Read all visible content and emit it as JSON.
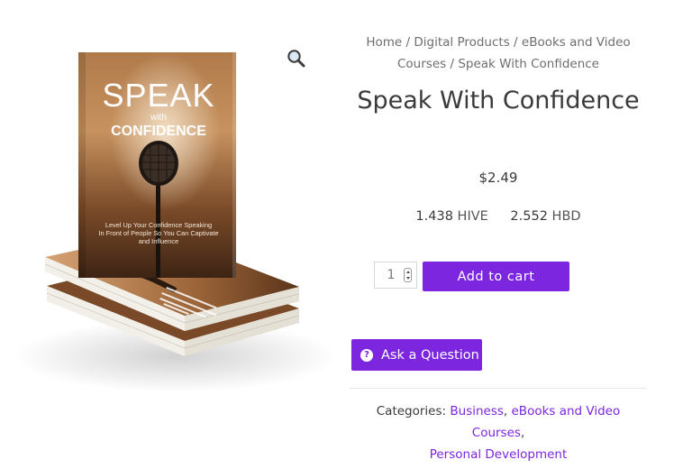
{
  "breadcrumb": {
    "items": [
      "Home",
      "Digital Products",
      "eBooks and Video Courses"
    ],
    "current": "Speak With Confidence",
    "separator": " / "
  },
  "product": {
    "title": "Speak With Confidence",
    "price": "$2.49",
    "alt_prices": [
      {
        "amount": "1.438",
        "unit": "HIVE"
      },
      {
        "amount": "2.552",
        "unit": "HBD"
      }
    ]
  },
  "cover": {
    "title_line1": "SPEAK",
    "title_line2": "with",
    "title_line3": "CONFIDENCE",
    "tagline_1": "Level Up Your Confidence Speaking",
    "tagline_2": "In Front of People So You Can Captivate",
    "tagline_3": "and Influence"
  },
  "cart": {
    "quantity": "1",
    "add_label": "Add to cart"
  },
  "ask": {
    "label": "Ask a Question",
    "icon": "question-circle-icon"
  },
  "zoom": {
    "icon": "magnifier-icon"
  },
  "categories": {
    "label": "Categories:",
    "items": [
      "Business",
      "eBooks and Video Courses",
      "Personal Development"
    ]
  },
  "colors": {
    "accent": "#7d26e0",
    "text": "#3a3a3a",
    "muted": "#6e6e6e"
  }
}
